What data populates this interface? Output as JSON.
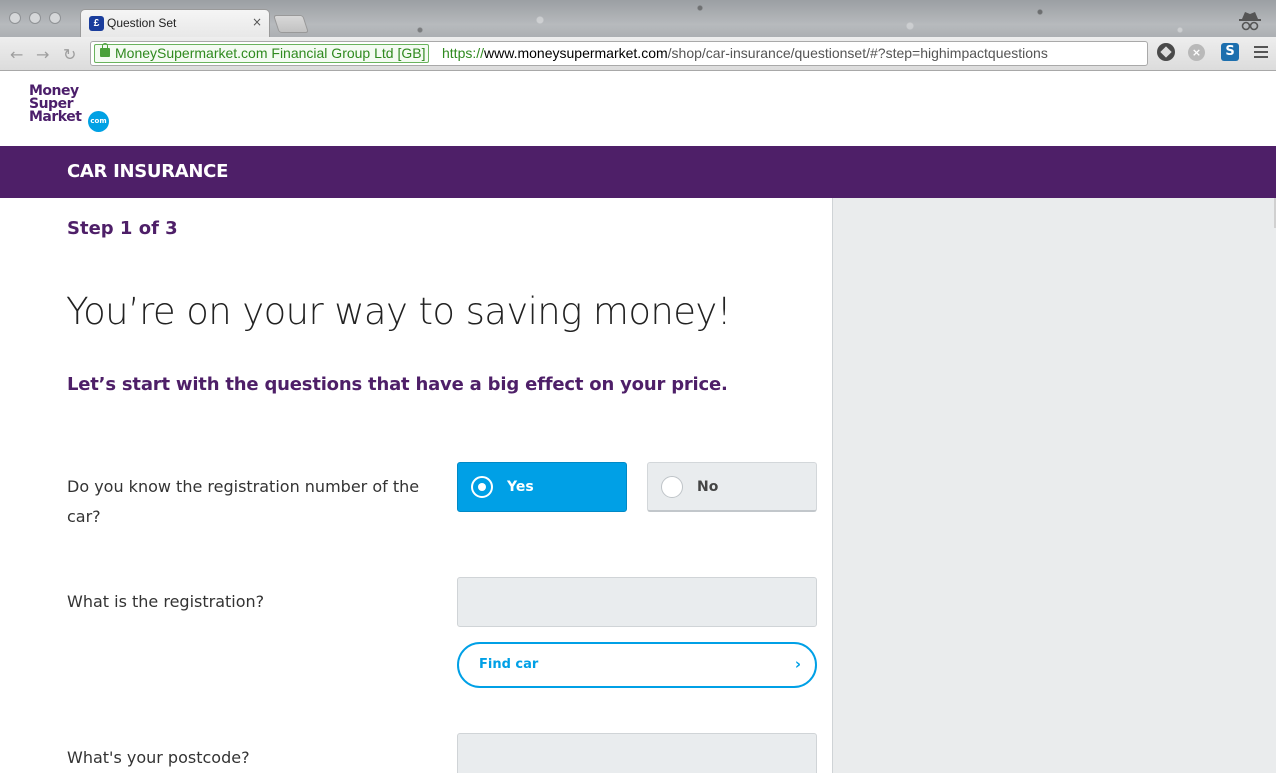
{
  "browser": {
    "tab_title": "Question Set",
    "tab_close": "×",
    "ev_label": "MoneySupermarket.com Financial Group Ltd [GB]",
    "url_scheme": "https://",
    "url_host": "www.moneysupermarket.com",
    "url_path": "/shop/car-insurance/questionset/#?step=highimpactquestions",
    "back_icon": "arrow-left-icon",
    "forward_icon": "arrow-right-icon",
    "reload_icon": "reload-icon",
    "bookmark_icon": "star-icon",
    "extensions": [
      "hexagon-extension-icon",
      "close-circle-extension-icon",
      "s-extension-icon"
    ],
    "ext2_glyph": "×",
    "ext3_glyph": "S"
  },
  "site": {
    "logo_lines": [
      "Money",
      "Super",
      "Market"
    ],
    "logo_badge": "com",
    "section_title": "CAR INSURANCE"
  },
  "form": {
    "step": "Step 1 of 3",
    "headline": "You’re on your way to saving money!",
    "subhead": "Let’s start with the questions that have a big effect on your price.",
    "q1": {
      "label": "Do you know the registration number of the car?",
      "options": [
        "Yes",
        "No"
      ],
      "selected": "Yes"
    },
    "q2": {
      "label": "What is the registration?",
      "value": "",
      "button": "Find car",
      "button_chevron": "›"
    },
    "q3": {
      "label": "What's your postcode?",
      "value": ""
    }
  },
  "colors": {
    "brand_purple": "#4e1f68",
    "accent_blue": "#00a0e6",
    "panel_grey": "#eaeced"
  }
}
